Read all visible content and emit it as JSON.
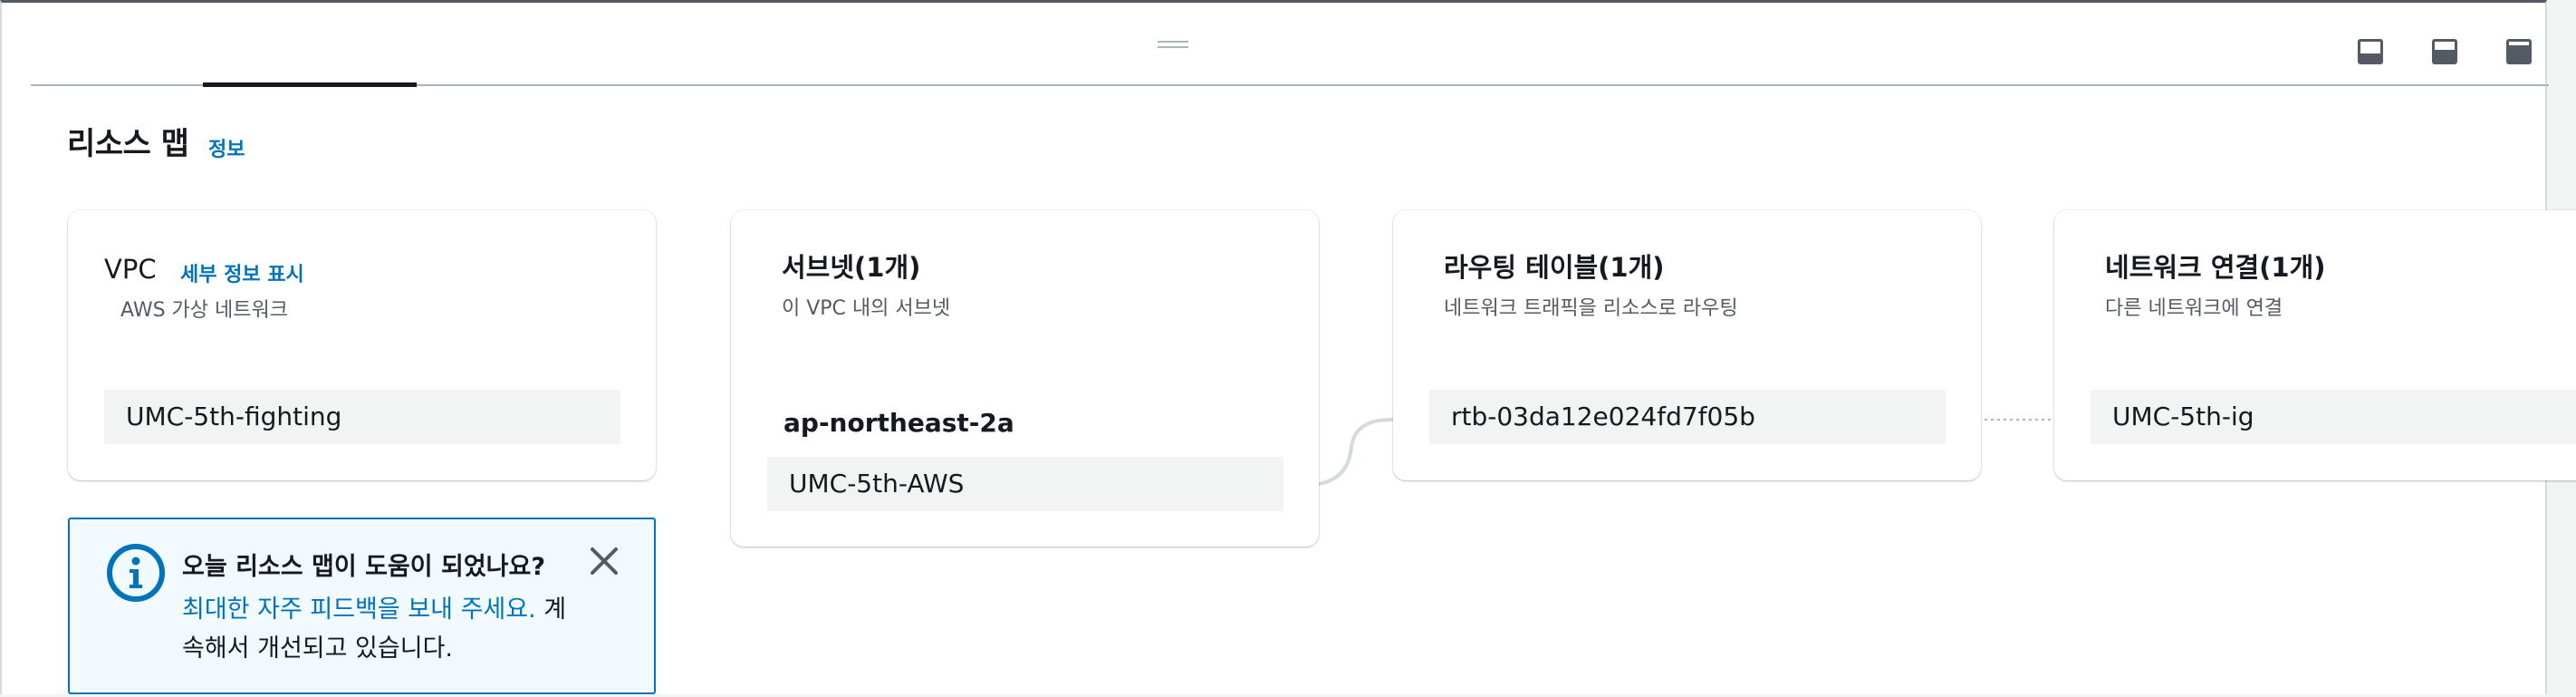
{
  "section": {
    "title": "리소스 맵",
    "info_link": "정보"
  },
  "vpc_card": {
    "title": "VPC",
    "details_link": "세부 정보 표시",
    "subtitle": "AWS 가상 네트워크",
    "items": [
      "UMC-5th-fighting"
    ]
  },
  "subnet_card": {
    "title": "서브넷(1개)",
    "subtitle": "이 VPC 내의 서브넷",
    "availability_zone": "ap-northeast-2a",
    "items": [
      "UMC-5th-AWS"
    ]
  },
  "route_card": {
    "title": "라우팅 테이블(1개)",
    "subtitle": "네트워크 트래픽을 리소스로 라우팅",
    "items": [
      "rtb-03da12e024fd7f05b"
    ]
  },
  "network_card": {
    "title": "네트워크 연결(1개)",
    "subtitle": "다른 네트워크에 연결",
    "items": [
      "UMC-5th-ig"
    ]
  },
  "feedback_alert": {
    "title": "오늘 리소스 맵이 도움이 되었나요?",
    "link_text": "최대한 자주 피드백을 보내 주세요.",
    "body_text": " 계속해서 개선되고 있습니다."
  },
  "icons": {
    "drag_handle": "drag-handle-icon",
    "view_bottom": "split-bottom-icon",
    "view_side": "split-side-icon",
    "view_full": "full-screen-icon",
    "info": "info-circle-icon",
    "close": "close-icon"
  },
  "colors": {
    "link": "#0073bb",
    "alert_border": "#0073bb",
    "alert_background": "#f1faff",
    "node_background": "#f2f3f3"
  }
}
